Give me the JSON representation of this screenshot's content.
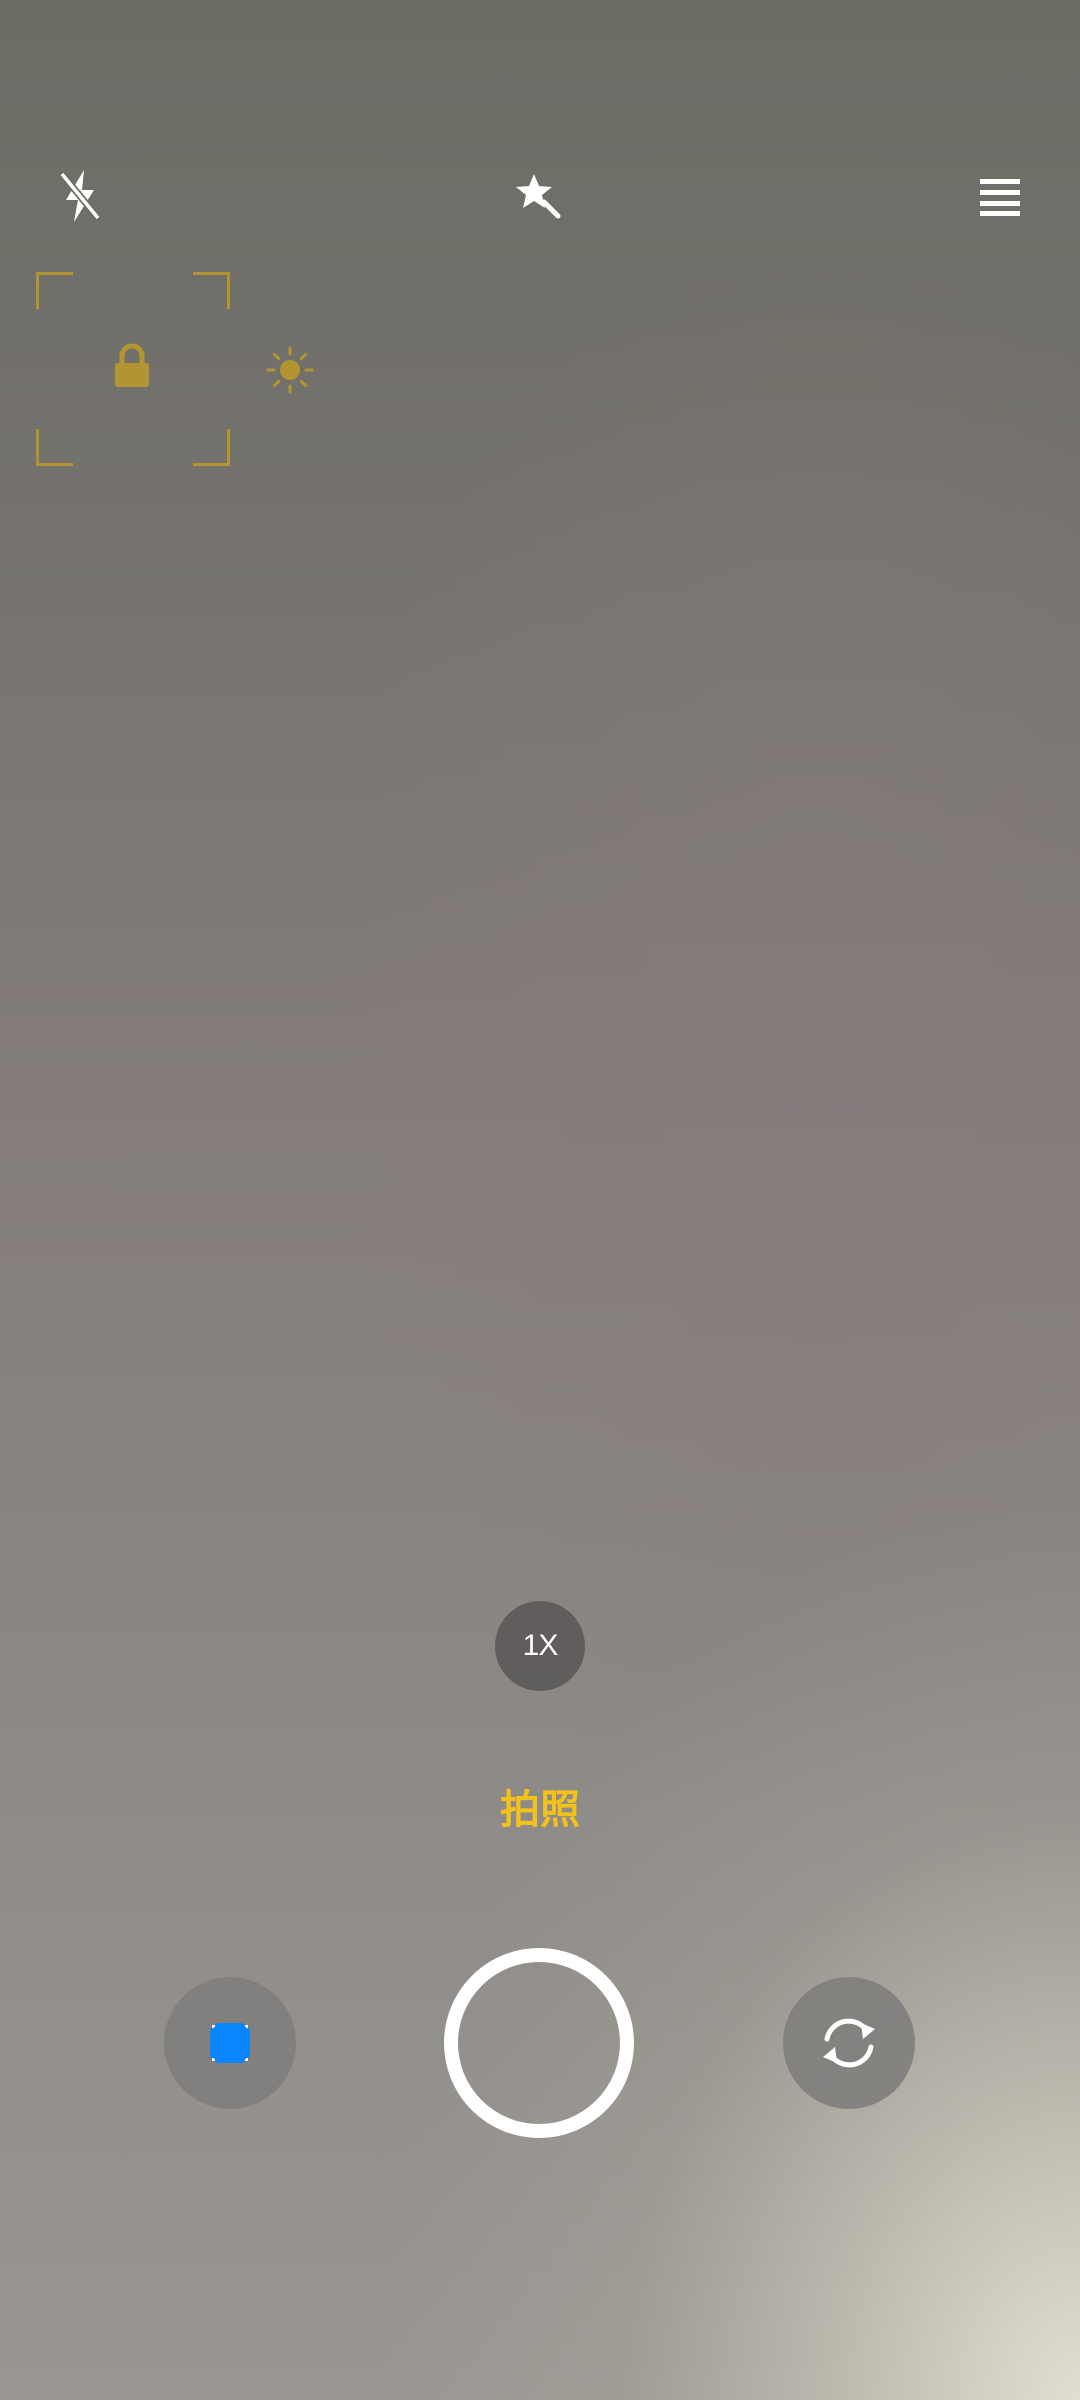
{
  "top_bar": {
    "flash_icon": "flash-off-icon",
    "effects_icon": "magic-effects-icon",
    "menu_icon": "menu-icon"
  },
  "focus_indicator": {
    "lock_icon": "lock-icon",
    "exposure_icon": "sun-icon",
    "color": "#b29433"
  },
  "zoom": {
    "label": "1X"
  },
  "mode": {
    "label": "拍照",
    "color": "#f2c21a"
  },
  "bottom_controls": {
    "gallery_thumbnail_icon": "gallery-thumbnail-icon",
    "gallery_color": "#0a84ff",
    "shutter_icon": "shutter-icon",
    "switch_camera_icon": "switch-camera-icon"
  }
}
